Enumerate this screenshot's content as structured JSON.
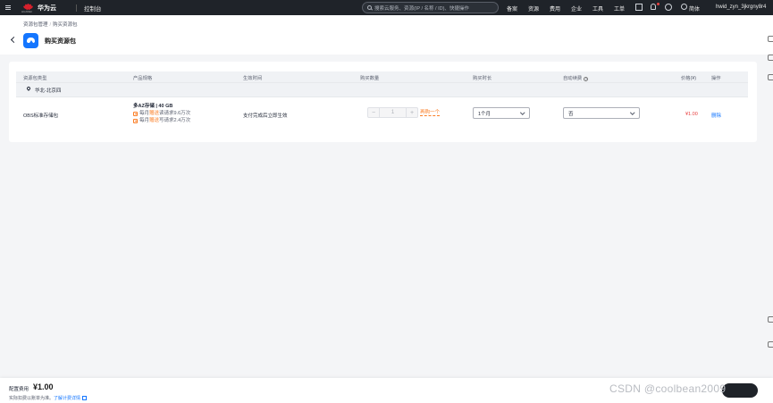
{
  "topbar": {
    "brand": "华为云",
    "logo_caption": "HUAWEI",
    "console": "控制台",
    "search_placeholder": "搜索云服务、资源(IP / 名称 / ID)、快捷操作",
    "links": [
      "备案",
      "资源",
      "费用",
      "企业",
      "工具",
      "工单"
    ],
    "language": "简体",
    "username": "hwid_zyn_3jkrgny8r4"
  },
  "breadcrumb": {
    "parent": "资源包管理",
    "separator": "/",
    "current": "购买资源包"
  },
  "page": {
    "title": "购买资源包"
  },
  "table": {
    "headers": {
      "type": "资源包类型",
      "spec": "产品规格",
      "effective": "生效时间",
      "quantity": "购买数量",
      "duration": "购买时长",
      "auto_renew": "自动续费",
      "price": "价格(¥)",
      "action": "操作"
    },
    "region": "华北-北京四",
    "rows": [
      {
        "type": "OBS标准存储包",
        "spec_title": "多AZ存储 | 40 GB",
        "spec_lines": [
          {
            "prefix": "每月",
            "highlight": "赠送",
            "suffix": "读请求9.6万次"
          },
          {
            "prefix": "每月",
            "highlight": "赠送",
            "suffix": "写请求2.4万次"
          }
        ],
        "effective": "支付完成后立即生效",
        "quantity_minus": "−",
        "quantity": "1",
        "quantity_plus": "+",
        "buy_one_more": "再购一个",
        "duration": "1个月",
        "auto_renew": "否",
        "price": "¥1.00",
        "action": "删除"
      }
    ]
  },
  "footer": {
    "fee_label": "配置费用",
    "fee_value": "¥1.00",
    "note": "实际扣费以账单为准。",
    "link": "了解计费详情"
  },
  "watermark": "CSDN @coolbean2009",
  "colors": {
    "brand_red": "#d6202c",
    "accent_blue": "#1476ff",
    "highlight_orange": "#fa7d24",
    "price_red": "#e84141",
    "topbar": "#1f2329"
  }
}
